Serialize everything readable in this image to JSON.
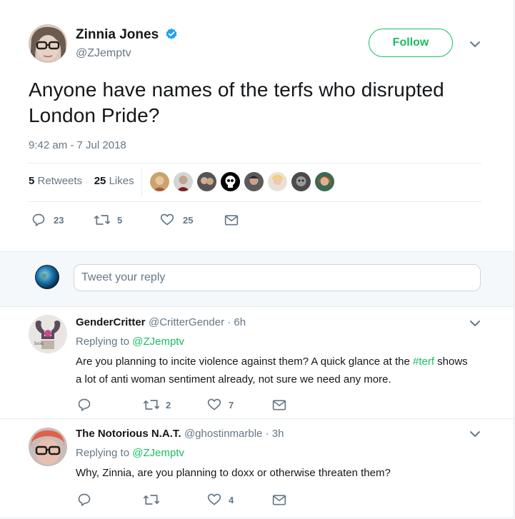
{
  "tweet": {
    "author_name": "Zinnia Jones",
    "author_handle": "@ZJemptv",
    "follow_label": "Follow",
    "text": "Anyone have names of the terfs who disrupted London Pride?",
    "timestamp": "9:42 am - 7 Jul 2018",
    "retweets_count": "5",
    "retweets_label": "Retweets",
    "likes_count": "25",
    "likes_label": "Likes",
    "reply_count": "23",
    "retweet_count": "5",
    "like_count": "25"
  },
  "reply_box": {
    "placeholder": "Tweet your reply"
  },
  "replies": [
    {
      "name": "GenderCritter",
      "meta": "@CritterGender · 6h",
      "replying_prefix": "Replying to",
      "replying_handle": "@ZJemptv",
      "text_before": "Are you planning to incite violence against them? A quick glance at the ",
      "hashtag": "#terf",
      "text_after": " shows a lot of anti woman sentiment already, not sure we need any more.",
      "reply_count": "",
      "retweet_count": "2",
      "like_count": "7"
    },
    {
      "name": "The Notorious N.A.T.",
      "meta": "@ghostinmarble · 3h",
      "replying_prefix": "Replying to",
      "replying_handle": "@ZJemptv",
      "text": "Why, Zinnia, are you planning to doxx or otherwise threaten them?",
      "reply_count": "",
      "retweet_count": "",
      "like_count": "4"
    }
  ],
  "icons": {
    "verified": "verified-badge-icon",
    "caret": "chevron-down-icon",
    "reply": "reply-icon",
    "retweet": "retweet-icon",
    "like": "heart-icon",
    "dm": "envelope-icon"
  },
  "colors": {
    "accent": "#17bf63",
    "verified": "#1da1f2",
    "muted": "#657786",
    "text": "#14171a"
  }
}
